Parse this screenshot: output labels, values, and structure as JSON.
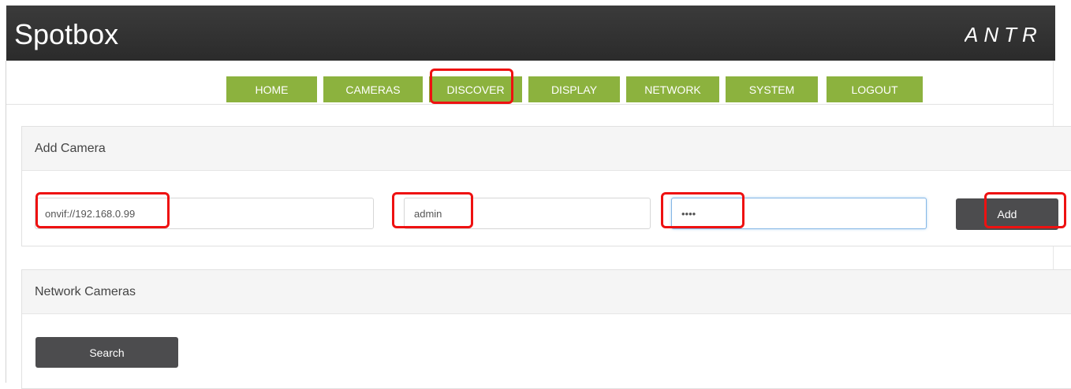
{
  "header": {
    "title": "Spotbox",
    "logo_text": "ANTR"
  },
  "nav": {
    "items": [
      {
        "label": "HOME"
      },
      {
        "label": "CAMERAS"
      },
      {
        "label": "DISCOVER"
      },
      {
        "label": "DISPLAY"
      },
      {
        "label": "NETWORK"
      },
      {
        "label": "SYSTEM"
      },
      {
        "label": "LOGOUT"
      }
    ]
  },
  "add_camera": {
    "heading": "Add Camera",
    "address_value": "onvif://192.168.0.99",
    "username_value": "admin",
    "password_value": "••••",
    "add_label": "Add"
  },
  "network_cameras": {
    "heading": "Network Cameras",
    "search_label": "Search"
  },
  "colors": {
    "header_bg": "#2f2f2f",
    "nav_green": "#8cb23e",
    "button_dark": "#4c4c4e",
    "highlight_red": "#ee1111"
  }
}
